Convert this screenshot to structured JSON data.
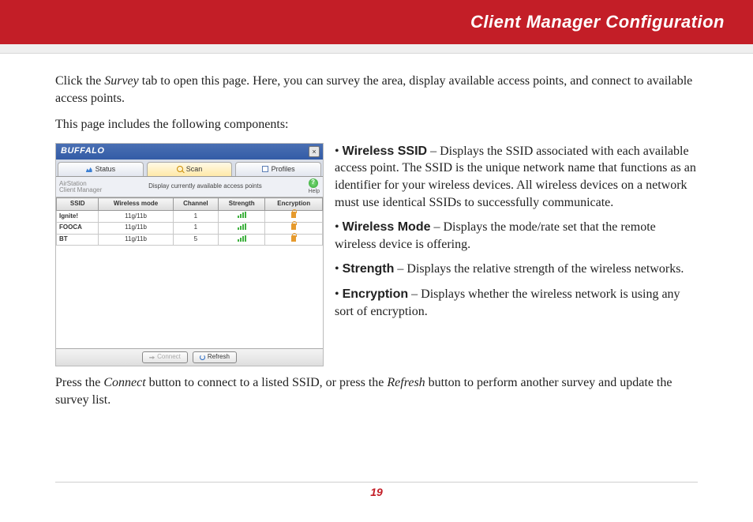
{
  "header": {
    "title": "Client Manager Configuration"
  },
  "intro": {
    "p1_a": "Click the ",
    "p1_survey": "Survey",
    "p1_b": " tab to open this page. Here, you can survey the area, display available access points, and connect to available access points.",
    "p2": "This page includes the following components:"
  },
  "screenshot": {
    "logo": "BUFFALO",
    "close": "×",
    "tabs": {
      "status": "Status",
      "scan": "Scan",
      "profiles": "Profiles"
    },
    "subhead_left_l1": "AirStation",
    "subhead_left_l2": "Client Manager",
    "subhead_center": "Display currently available access points",
    "help": "?",
    "help_label": "Help",
    "columns": [
      "SSID",
      "Wireless mode",
      "Channel",
      "Strength",
      "Encryption"
    ],
    "rows": [
      {
        "ssid": "Ignite!",
        "mode": "11g/11b",
        "channel": "1"
      },
      {
        "ssid": "FOOCA",
        "mode": "11g/11b",
        "channel": "1"
      },
      {
        "ssid": "BT",
        "mode": "11g/11b",
        "channel": "5"
      }
    ],
    "buttons": {
      "connect": "Connect",
      "refresh": "Refresh"
    }
  },
  "bullets": {
    "ssid_label": "Wireless SSID",
    "ssid_text": " – Displays the SSID associated with each available access point. The SSID is the unique network name that functions as an identifier for your wireless devices. All wireless devices on a network must use identical SSIDs to successfully communicate.",
    "mode_label": "Wireless Mode",
    "mode_text": " – Displays the mode/rate set that the remote wireless device is offering.",
    "strength_label": "Strength",
    "strength_text": " – Displays the relative strength of the wireless networks.",
    "enc_label": "Encryption",
    "enc_text": " – Displays whether the wireless network is using any sort of encryption."
  },
  "outro": {
    "a": "Press the ",
    "connect": "Connect",
    "b": " button to connect to a listed SSID, or press the ",
    "refresh": "Refresh",
    "c": " button to perform another survey and update the survey list."
  },
  "page_number": "19"
}
